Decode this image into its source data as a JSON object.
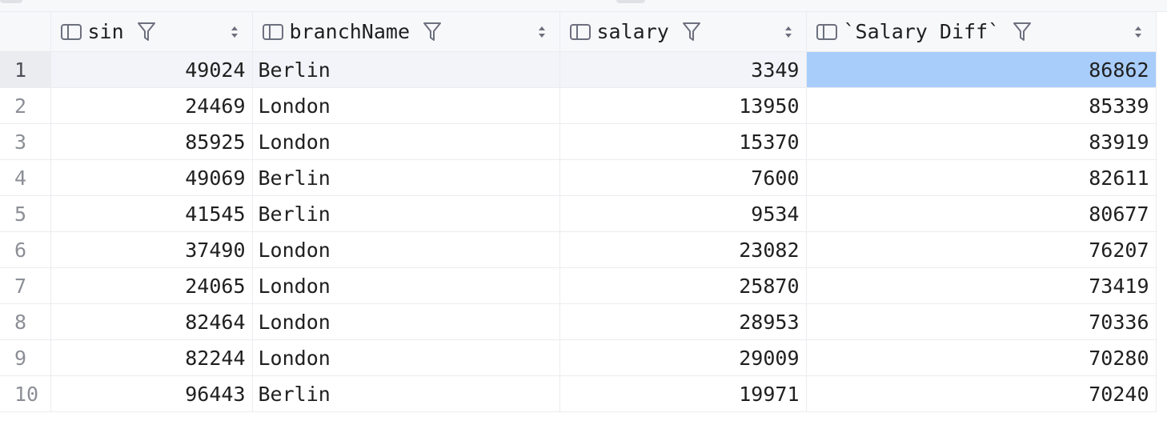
{
  "columns": [
    {
      "name": "sin",
      "label": "sin",
      "align": "right"
    },
    {
      "name": "branchName",
      "label": "branchName",
      "align": "left"
    },
    {
      "name": "salary",
      "label": "salary",
      "align": "right"
    },
    {
      "name": "salary-diff",
      "label": "`Salary Diff`",
      "align": "right"
    }
  ],
  "rows": [
    {
      "n": "1",
      "sin": "49024",
      "branchName": "Berlin",
      "salary": "3349",
      "diff": "86862"
    },
    {
      "n": "2",
      "sin": "24469",
      "branchName": "London",
      "salary": "13950",
      "diff": "85339"
    },
    {
      "n": "3",
      "sin": "85925",
      "branchName": "London",
      "salary": "15370",
      "diff": "83919"
    },
    {
      "n": "4",
      "sin": "49069",
      "branchName": "Berlin",
      "salary": "7600",
      "diff": "82611"
    },
    {
      "n": "5",
      "sin": "41545",
      "branchName": "Berlin",
      "salary": "9534",
      "diff": "80677"
    },
    {
      "n": "6",
      "sin": "37490",
      "branchName": "London",
      "salary": "23082",
      "diff": "76207"
    },
    {
      "n": "7",
      "sin": "24065",
      "branchName": "London",
      "salary": "25870",
      "diff": "73419"
    },
    {
      "n": "8",
      "sin": "82464",
      "branchName": "London",
      "salary": "28953",
      "diff": "70336"
    },
    {
      "n": "9",
      "sin": "82244",
      "branchName": "London",
      "salary": "29009",
      "diff": "70280"
    },
    {
      "n": "10",
      "sin": "96443",
      "branchName": "Berlin",
      "salary": "19971",
      "diff": "70240"
    }
  ],
  "selection": {
    "row": "1",
    "column": "`Salary Diff`"
  },
  "icons": {
    "column": "column-icon",
    "filter": "filter-icon",
    "sort": "sort-icon"
  },
  "colors": {
    "header_bg": "#f7f8fa",
    "selected_cell": "#a8cdfb",
    "current_row": "#f2f4f9",
    "grid_line": "#ebecf0",
    "row_number": "#8c8f96"
  }
}
